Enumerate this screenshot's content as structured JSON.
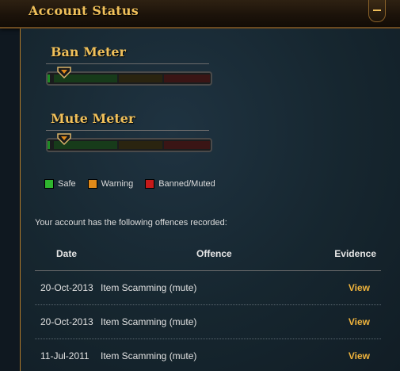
{
  "header": {
    "title": "Account Status"
  },
  "meters": {
    "ban": {
      "title": "Ban Meter",
      "level": 0.0
    },
    "mute": {
      "title": "Mute Meter",
      "level": 0.0
    }
  },
  "legend": {
    "safe": {
      "label": "Safe",
      "color": "#2fb52f"
    },
    "warning": {
      "label": "Warning",
      "color": "#e08a1a"
    },
    "banned": {
      "label": "Banned/Muted",
      "color": "#c41a1a"
    }
  },
  "offences": {
    "intro": "Your account has the following offences recorded:",
    "headers": {
      "date": "Date",
      "offence": "Offence",
      "evidence": "Evidence"
    },
    "rows": [
      {
        "date": "20-Oct-2013",
        "offence": "Item Scamming (mute)",
        "evidence": "View"
      },
      {
        "date": "20-Oct-2013",
        "offence": "Item Scamming (mute)",
        "evidence": "View"
      },
      {
        "date": "11-Jul-2011",
        "offence": "Item Scamming (mute)",
        "evidence": "View"
      }
    ]
  },
  "colors": {
    "accent_gold": "#f0c05a",
    "link": "#f0b43c"
  }
}
